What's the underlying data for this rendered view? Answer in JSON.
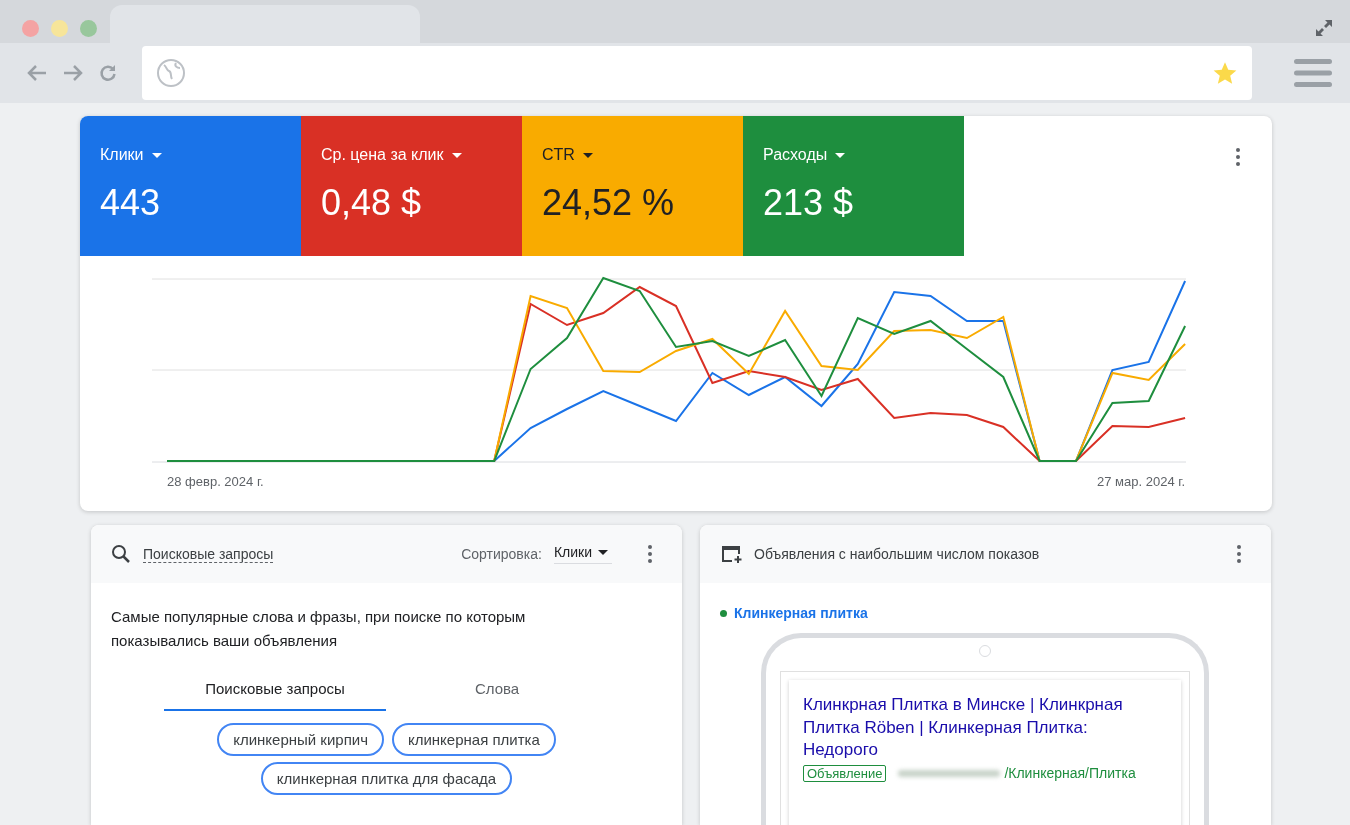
{
  "metrics": [
    {
      "label": "Клики",
      "value": "443",
      "color": "#1a73e8"
    },
    {
      "label": "Ср. цена за клик",
      "value": "0,48 $",
      "color": "#d93025"
    },
    {
      "label": "CTR",
      "value": "24,52 %",
      "color": "#f9ab00"
    },
    {
      "label": "Расходы",
      "value": "213 $",
      "color": "#1e8e3e"
    }
  ],
  "chart": {
    "start_label": "28 февр. 2024 г.",
    "end_label": "27 мар. 2024 г."
  },
  "queries_card": {
    "title": "Поисковые запросы",
    "sort_label": "Сортировка:",
    "sort_value": "Клики",
    "description": "Самые популярные слова и фразы, при поиске по которым показывались ваши объявления",
    "tabs": [
      {
        "label": "Поисковые запросы",
        "selected": true
      },
      {
        "label": "Слова",
        "selected": false
      }
    ],
    "chips": [
      "клинкерный кирпич",
      "клинкерная плитка",
      "клинкерная плитка для фасада"
    ]
  },
  "ads_card": {
    "title": "Объявления с наибольшим числом показов",
    "ad_group": {
      "name": "Клинкерная плитка",
      "color": "#1e8e3e"
    },
    "ad": {
      "headline": "Клинкрная Плитка в Минске | Клинкрная Плитка Röben | Клинкерная Плитка: Недорого",
      "badge": "Объявление",
      "url_path": "/Клинкерная/Плитка"
    }
  }
}
